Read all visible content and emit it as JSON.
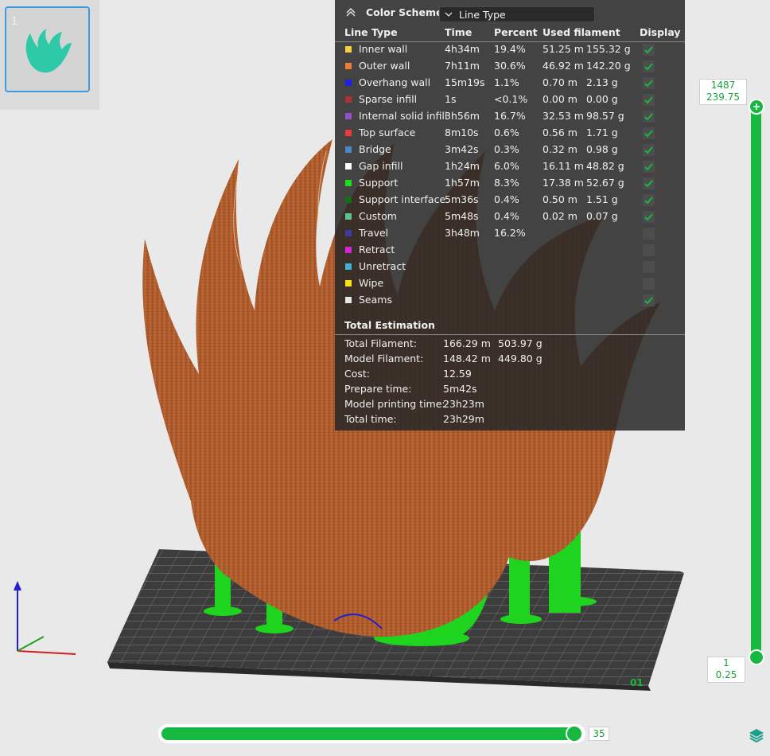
{
  "thumbnail": {
    "number": "1"
  },
  "color_scheme": {
    "title": "Color Scheme",
    "selected": "Line Type",
    "columns": {
      "line_type": "Line Type",
      "time": "Time",
      "percent": "Percent",
      "used_filament": "Used filament",
      "display": "Display"
    },
    "rows": [
      {
        "name": "Inner wall",
        "color": "#f5d142",
        "time": "4h34m",
        "percent": "19.4%",
        "length": "51.25 m",
        "weight": "155.32 g",
        "checked": true
      },
      {
        "name": "Outer wall",
        "color": "#f07b36",
        "time": "7h11m",
        "percent": "30.6%",
        "length": "46.92 m",
        "weight": "142.20 g",
        "checked": true
      },
      {
        "name": "Overhang wall",
        "color": "#1f1fe6",
        "time": "15m19s",
        "percent": "1.1%",
        "length": "0.70 m",
        "weight": "2.13 g",
        "checked": true
      },
      {
        "name": "Sparse infill",
        "color": "#b0312f",
        "time": "1s",
        "percent": "<0.1%",
        "length": "0.00 m",
        "weight": "0.00 g",
        "checked": true
      },
      {
        "name": "Internal solid infill",
        "color": "#9550c6",
        "time": "3h56m",
        "percent": "16.7%",
        "length": "32.53 m",
        "weight": "98.57 g",
        "checked": true
      },
      {
        "name": "Top surface",
        "color": "#f03a3a",
        "time": "8m10s",
        "percent": "0.6%",
        "length": "0.56 m",
        "weight": "1.71 g",
        "checked": true
      },
      {
        "name": "Bridge",
        "color": "#4f86c6",
        "time": "3m42s",
        "percent": "0.3%",
        "length": "0.32 m",
        "weight": "0.98 g",
        "checked": true
      },
      {
        "name": "Gap infill",
        "color": "#ffffff",
        "time": "1h24m",
        "percent": "6.0%",
        "length": "16.11 m",
        "weight": "48.82 g",
        "checked": true
      },
      {
        "name": "Support",
        "color": "#1cde1c",
        "time": "1h57m",
        "percent": "8.3%",
        "length": "17.38 m",
        "weight": "52.67 g",
        "checked": true
      },
      {
        "name": "Support interface",
        "color": "#136f13",
        "time": "5m36s",
        "percent": "0.4%",
        "length": "0.50 m",
        "weight": "1.51 g",
        "checked": true
      },
      {
        "name": "Custom",
        "color": "#5ec28c",
        "time": "5m48s",
        "percent": "0.4%",
        "length": "0.02 m",
        "weight": "0.07 g",
        "checked": true
      },
      {
        "name": "Travel",
        "color": "#3b3ba8",
        "time": "3h48m",
        "percent": "16.2%",
        "length": "",
        "weight": "",
        "checked": false
      },
      {
        "name": "Retract",
        "color": "#d526d5",
        "time": "",
        "percent": "",
        "length": "",
        "weight": "",
        "checked": false
      },
      {
        "name": "Unretract",
        "color": "#3ab3d6",
        "time": "",
        "percent": "",
        "length": "",
        "weight": "",
        "checked": false
      },
      {
        "name": "Wipe",
        "color": "#f5e21a",
        "time": "",
        "percent": "",
        "length": "",
        "weight": "",
        "checked": false
      },
      {
        "name": "Seams",
        "color": "#e6e6e6",
        "time": "",
        "percent": "",
        "length": "",
        "weight": "",
        "checked": true
      }
    ]
  },
  "total": {
    "title": "Total Estimation",
    "rows": [
      {
        "label": "Total Filament:",
        "value1": "166.29 m",
        "value2": "503.97 g"
      },
      {
        "label": "Model Filament:",
        "value1": "148.42 m",
        "value2": "449.80 g"
      },
      {
        "label": "Cost:",
        "value1": "12.59",
        "value2": ""
      },
      {
        "label": "Prepare time:",
        "value1": "5m42s",
        "value2": ""
      },
      {
        "label": "Model printing time:",
        "value1": "23h23m",
        "value2": ""
      },
      {
        "label": "Total time:",
        "value1": "23h29m",
        "value2": ""
      }
    ]
  },
  "layer_slider": {
    "top_layer": "1487",
    "top_height": "239.75",
    "bottom_layer": "1",
    "bottom_height": "0.25"
  },
  "move_slider": {
    "value": "35"
  },
  "colors": {
    "accent": "#17b83f"
  }
}
